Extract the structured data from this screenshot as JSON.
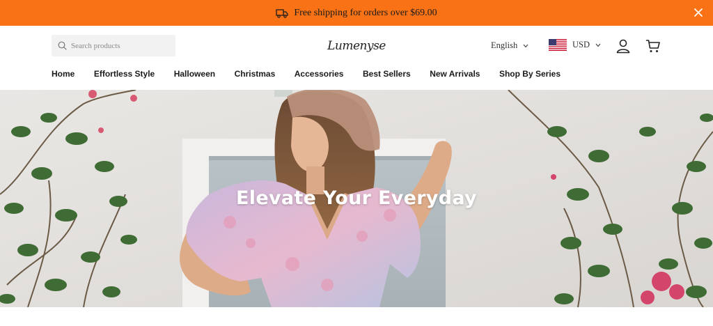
{
  "announcement": {
    "text": "Free shipping for orders over $69.00",
    "icon": "truck-icon",
    "close_icon": "close-icon",
    "background": "#f97316"
  },
  "header": {
    "search": {
      "placeholder": "Search products",
      "icon": "search-icon"
    },
    "logo_text": "Lumenyse",
    "language": {
      "selected": "English"
    },
    "currency": {
      "selected": "USD",
      "flag": "us-flag-icon"
    },
    "account_icon": "user-icon",
    "cart_icon": "cart-icon"
  },
  "nav": {
    "items": [
      "Home",
      "Effortless Style",
      "Halloween",
      "Christmas",
      "Accessories",
      "Best Sellers",
      "New Arrivals",
      "Shop By Series"
    ]
  },
  "hero": {
    "title": "Elevate Your Everyday"
  }
}
